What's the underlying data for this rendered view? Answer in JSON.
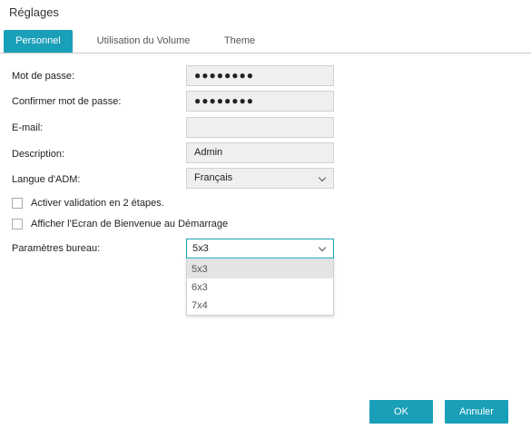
{
  "window": {
    "title": "Réglages"
  },
  "tabs": [
    {
      "label": "Personnel",
      "active": true
    },
    {
      "label": "Utilisation du Volume",
      "active": false
    },
    {
      "label": "Theme",
      "active": false
    }
  ],
  "form": {
    "password": {
      "label": "Mot de passe:",
      "value": "●●●●●●●●"
    },
    "confirm_password": {
      "label": "Confirmer mot de passe:",
      "value": "●●●●●●●●"
    },
    "email": {
      "label": "E-mail:",
      "value": ""
    },
    "description": {
      "label": "Description:",
      "value": "Admin"
    },
    "language": {
      "label": "Langue d'ADM:",
      "value": "Français"
    },
    "two_step": {
      "label": "Activer validation en 2 étapes.",
      "checked": false
    },
    "welcome_screen": {
      "label": "Afficher l'Ecran de Bienvenue au Démarrage",
      "checked": false
    },
    "desktop": {
      "label": "Paramètres bureau:",
      "value": "5x3",
      "options": [
        "5x3",
        "6x3",
        "7x4"
      ],
      "selected_index": 0,
      "open": true
    }
  },
  "buttons": {
    "ok": "OK",
    "cancel": "Annuler"
  },
  "colors": {
    "accent": "#1a9fb8",
    "field_bg": "#efefef",
    "divider": "#c9c9c9"
  },
  "icons": {
    "dropdown": "chevron-down-icon"
  }
}
